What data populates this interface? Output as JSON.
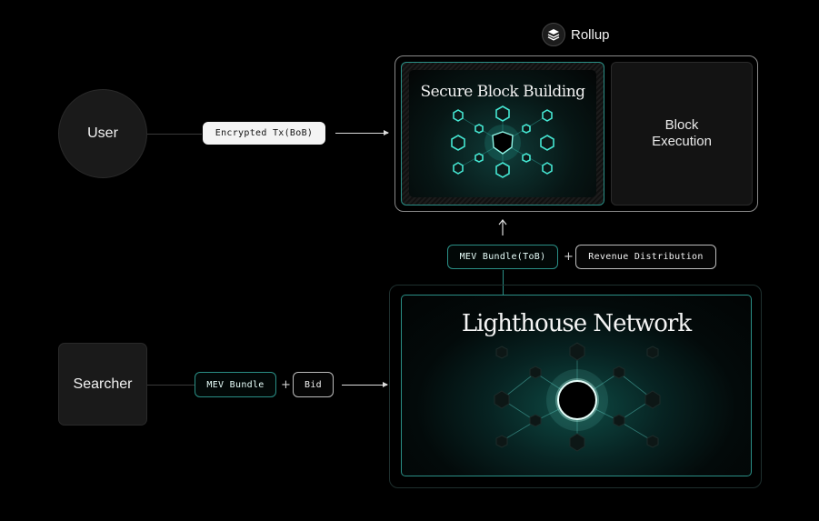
{
  "rollup": {
    "label": "Rollup",
    "icon": "layers-icon"
  },
  "user": {
    "label": "User"
  },
  "searcher": {
    "label": "Searcher"
  },
  "encrypted_tx": {
    "label": "Encrypted Tx(BoB)"
  },
  "secure_block_building": {
    "title": "Secure Block Building"
  },
  "block_execution": {
    "line1": "Block",
    "line2": "Execution"
  },
  "mev_bundle_tob": {
    "label": "MEV Bundle(ToB)"
  },
  "revenue_distribution": {
    "label": "Revenue Distribution"
  },
  "mev_bundle": {
    "label": "MEV Bundle"
  },
  "bid": {
    "label": "Bid"
  },
  "plus_symbol": "+",
  "lighthouse": {
    "title": "Lighthouse Network"
  },
  "colors": {
    "accent": "#2fd6c3",
    "accent_dark": "#1f6f68",
    "panel": "#121212"
  }
}
